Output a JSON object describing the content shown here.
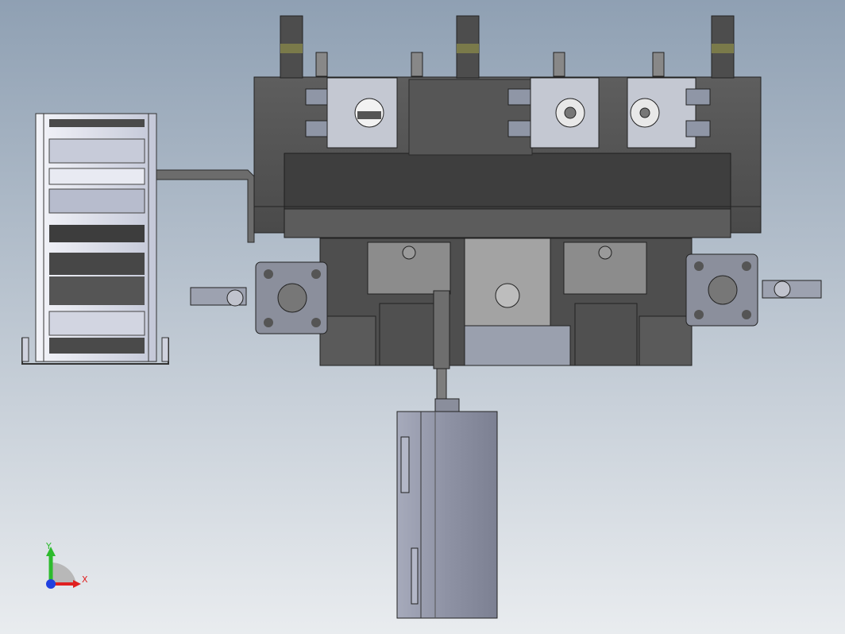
{
  "triad": {
    "y_label": "Y",
    "x_label": "X",
    "y_color": "#2dbb2d",
    "x_color": "#e02020",
    "z_color": "#2040e0"
  },
  "colors": {
    "dark_body": "#505050",
    "mid_body": "#6a6a6a",
    "light_body": "#8a8a8a",
    "steel": "#9ea3ad",
    "chain": "#d8dbe6",
    "cylinder": "#8f93a6"
  }
}
